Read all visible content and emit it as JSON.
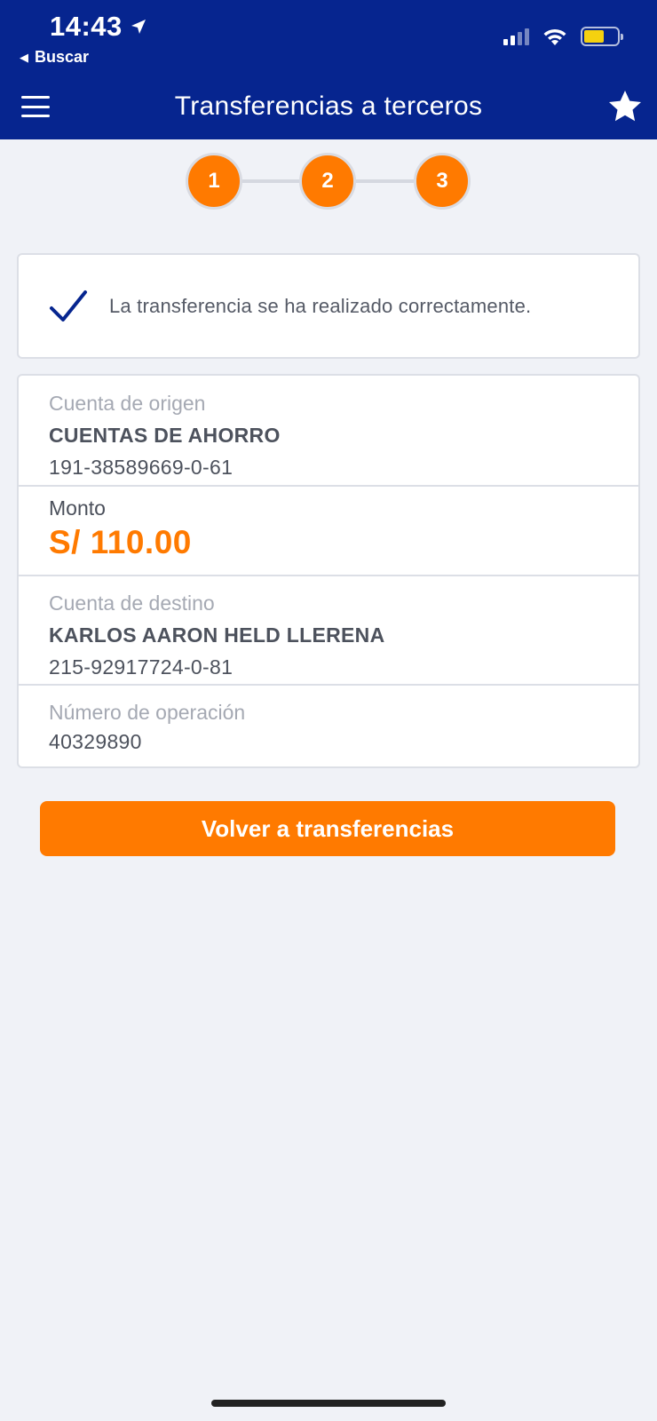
{
  "status_bar": {
    "time": "14:43",
    "back_label": "Buscar"
  },
  "nav": {
    "title": "Transferencias a terceros"
  },
  "stepper": {
    "steps": [
      "1",
      "2",
      "3"
    ],
    "active_color": "#ff7a00"
  },
  "success": {
    "message": "La transferencia se ha realizado correctamente."
  },
  "details": {
    "origin_label": "Cuenta de origen",
    "origin_type": "CUENTAS DE AHORRO",
    "origin_number": "191-38589669-0-61",
    "amount_label": "Monto",
    "amount_value": "S/ 110.00",
    "destination_label": "Cuenta de destino",
    "destination_name": "KARLOS AARON HELD LLERENA",
    "destination_number": "215-92917724-0-81",
    "operation_label": "Número de operación",
    "operation_number": "40329890"
  },
  "actions": {
    "back_button": "Volver a transferencias"
  },
  "colors": {
    "header": "#06258f",
    "accent": "#ff7a00",
    "background": "#f0f2f7"
  }
}
